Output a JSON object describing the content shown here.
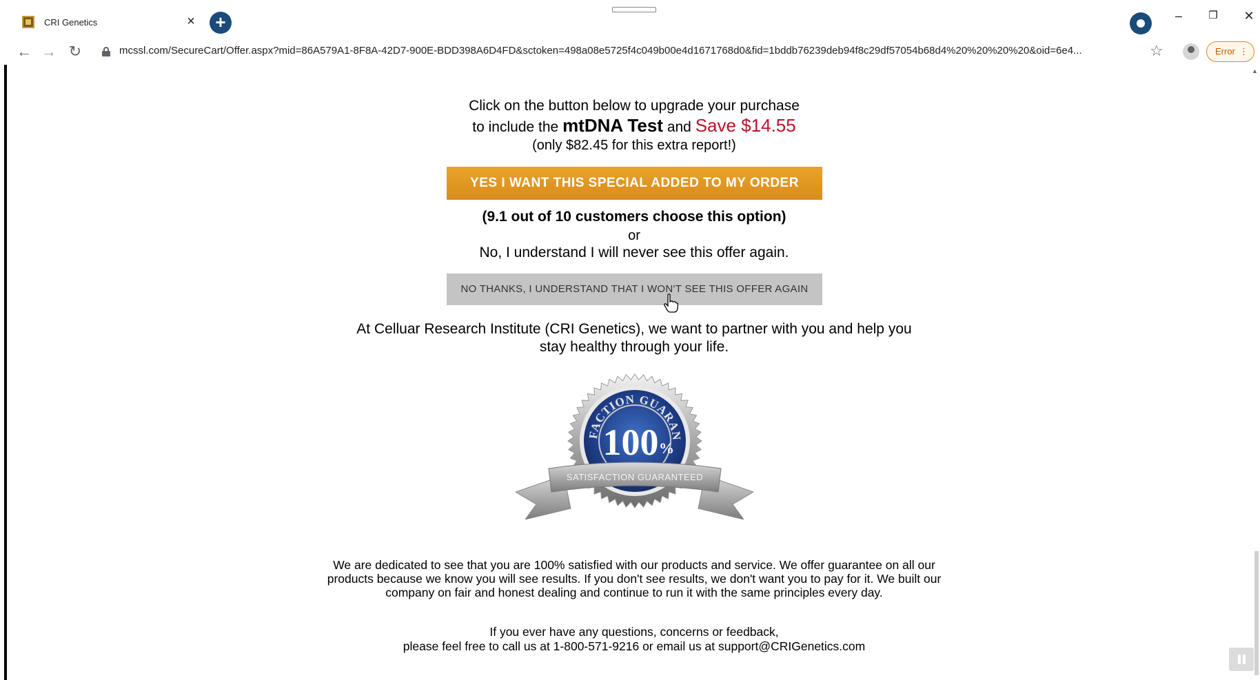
{
  "browser": {
    "tab_title": "CRI Genetics",
    "tab_close": "×",
    "new_tab": "+",
    "url": "mcssl.com/SecureCart/Offer.aspx?mid=86A579A1-8F8A-42D7-900E-BDD398A6D4FD&sctoken=498a08e5725f4c049b00e4d1671768d0&fid=1bddb76239deb94f8c29df57054b68d4%20%20%20%20&oid=6e4...",
    "error_label": "Error",
    "accent_color": "#1a4b7a"
  },
  "offer": {
    "line1": "Click on the button below to upgrade your purchase",
    "line2_prefix": "to include the",
    "line2_product": "mtDNA Test",
    "line2_and": "and",
    "line2_save": "Save $14.55",
    "line3": "(only $82.45 for this extra report!)",
    "yes_button": "YES I WANT THIS SPECIAL ADDED TO MY ORDER",
    "social_proof": "(9.1 out of 10 customers choose this option)",
    "or": "or",
    "decline_note": "No, I understand I will never see this offer again.",
    "no_button": "NO THANKS, I UNDERSTAND THAT I WON'T SEE THIS OFFER AGAIN",
    "yes_button_color": "#e29a25",
    "save_color": "#b8132a"
  },
  "about": {
    "line1": "At Celluar Research Institute (CRI Genetics), we want to partner with you and help you",
    "line2": "stay healthy through your life."
  },
  "seal": {
    "top_text": "SATISFACTION GUARANTEED",
    "percent": "100",
    "percent_sign": "%",
    "ribbon_text": "SATISFACTION GUARANTEED"
  },
  "guarantee": {
    "paragraph": "We are dedicated to see that you are 100% satisfied with our products and service. We offer guarantee on all our products because we know you will see results. If you don't see results, we don't want you to pay for it. We built our company on fair and honest dealing and continue to run it with the same principles every day.",
    "contact_line1": "If you ever have any questions, concerns or feedback,",
    "contact_line2": "please feel free to call us at 1-800-571-9216 or email us at support@CRIGenetics.com"
  }
}
